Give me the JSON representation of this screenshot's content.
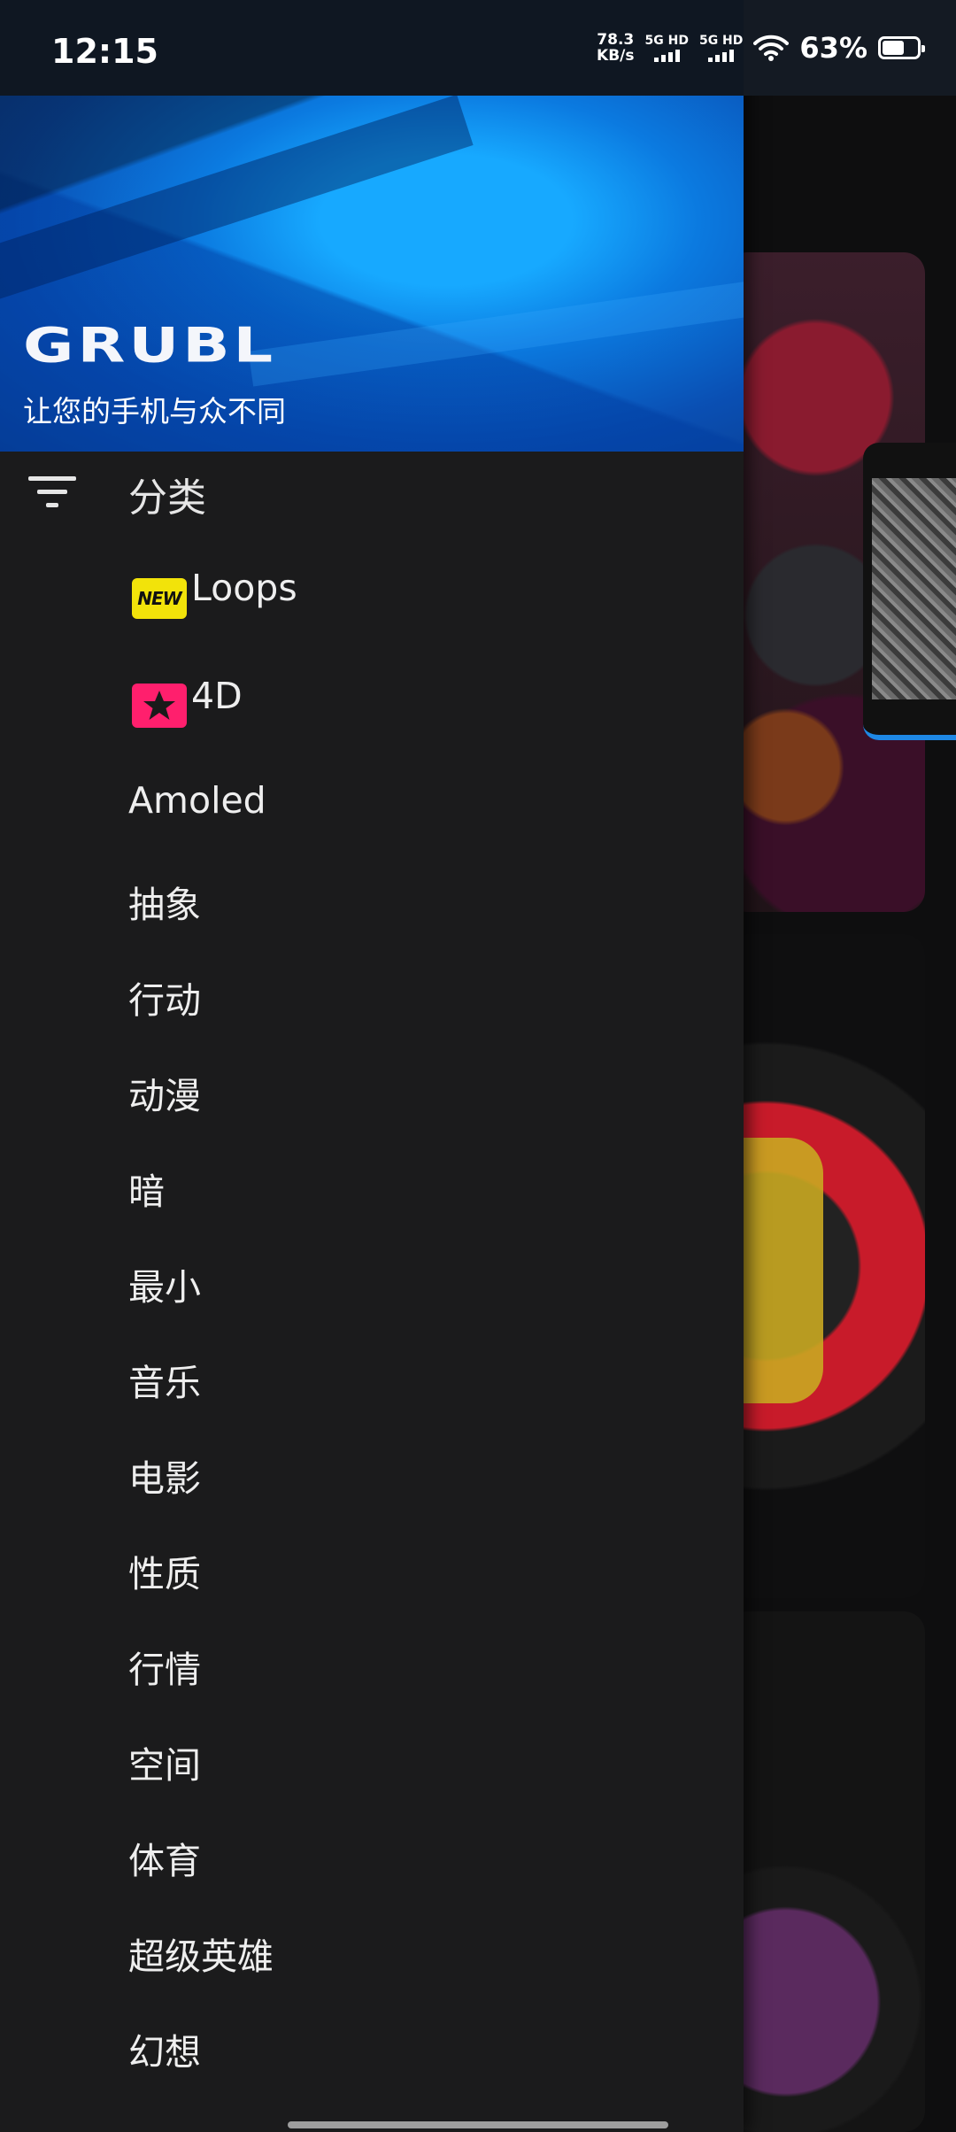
{
  "status_bar": {
    "time": "12:15",
    "net_speed_value": "78.3",
    "net_speed_unit": "KB/s",
    "sim1_label": "5G HD",
    "sim2_label": "5G HD",
    "battery_percent": "63%",
    "battery_level": 0.63
  },
  "drawer": {
    "logo_text": "GRUBL",
    "tagline": "让您的手机与众不同",
    "categories_title": "分类",
    "items": [
      {
        "label": "Loops",
        "badge": "NEW"
      },
      {
        "label": "4D",
        "badge": "star"
      },
      {
        "label": "Amoled"
      },
      {
        "label": "抽象"
      },
      {
        "label": "行动"
      },
      {
        "label": "动漫"
      },
      {
        "label": "暗"
      },
      {
        "label": "最小"
      },
      {
        "label": "音乐"
      },
      {
        "label": "电影"
      },
      {
        "label": "性质"
      },
      {
        "label": "行情"
      },
      {
        "label": "空间"
      },
      {
        "label": "体育"
      },
      {
        "label": "超级英雄"
      },
      {
        "label": "幻想"
      }
    ]
  },
  "colors": {
    "drawer_bg": "#1b1b1c",
    "new_badge": "#f2e30a",
    "star_badge": "#ff1f6d",
    "header_blue": "#0b7ae0"
  }
}
